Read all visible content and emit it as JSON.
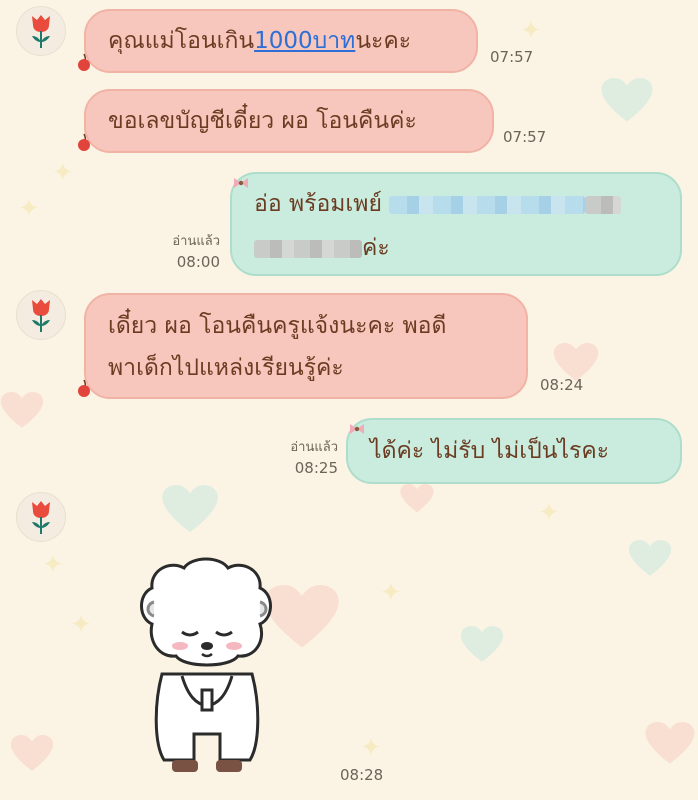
{
  "messages": [
    {
      "id": "m1",
      "text_before": "คุณแม่โอนเกิน",
      "link": "1000บาท",
      "text_after": "นะคะ",
      "time": "07:57"
    },
    {
      "id": "m2",
      "text": "ขอเลขบัญชีเดี๋ยว ผอ โอนคืนค่ะ",
      "time": "07:57"
    },
    {
      "id": "m3",
      "line1": "อ่อ พร้อมเพย์",
      "line2_suffix": "ค่ะ",
      "read": "อ่านแล้ว",
      "time": "08:00"
    },
    {
      "id": "m4",
      "line1": "เดี๋ยว ผอ โอนคืนครูแจ้งนะคะ พอดี",
      "line2": "พาเด็กไปแหล่งเรียนรู้ค่ะ",
      "time": "08:24"
    },
    {
      "id": "m5",
      "text": "ได้ค่ะ ไม่รับ ไม่เป็นไรคะ",
      "read": "อ่านแล้ว",
      "time": "08:25"
    },
    {
      "id": "m6",
      "sticker": "bowing-sheep-sticker",
      "time": "08:28"
    }
  ],
  "colors": {
    "incoming": "#f7c7bd",
    "outgoing": "#c9ecde",
    "text": "#6b3c22",
    "link": "#2d6fd6",
    "background": "#fbf4e4"
  },
  "icons": {
    "avatar": "red-tulip-icon",
    "incoming_tail": "cherry-icon",
    "outgoing_tail": "bow-icon"
  }
}
